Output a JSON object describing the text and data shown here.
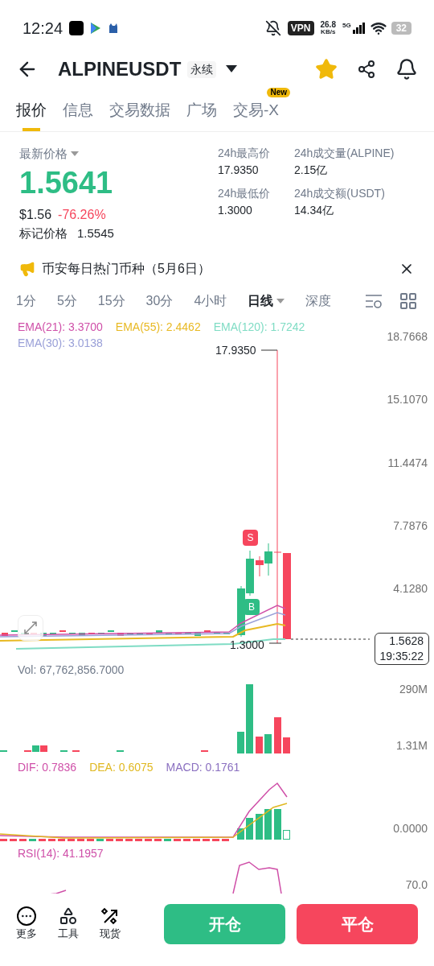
{
  "status_bar": {
    "time": "12:24",
    "vpn": "VPN",
    "speed": "26.8",
    "speed_unit": "KB/s",
    "network": "5G",
    "battery": "32"
  },
  "header": {
    "symbol": "ALPINEUSDT",
    "contract": "永续",
    "favorite": true
  },
  "tabs": [
    {
      "label": "报价",
      "selected": true
    },
    {
      "label": "信息",
      "selected": false
    },
    {
      "label": "交易数据",
      "selected": false
    },
    {
      "label": "广场",
      "selected": false
    },
    {
      "label": "交易-X",
      "selected": false,
      "badge": "New"
    }
  ],
  "price": {
    "label": "最新价格",
    "last": "1.5641",
    "usd": "$1.56",
    "change": "-76.26%",
    "mark_label": "标记价格",
    "mark": "1.5545"
  },
  "stats": [
    {
      "label": "24h最高价",
      "value": "17.9350"
    },
    {
      "label": "24h成交量(ALPINE)",
      "value": "2.15亿"
    },
    {
      "label": "24h最低价",
      "value": "1.3000"
    },
    {
      "label": "24h成交额(USDT)",
      "value": "14.34亿"
    }
  ],
  "banner": {
    "text": "币安每日热门币种（5月6日）"
  },
  "intervals": [
    {
      "label": "1分",
      "selected": false
    },
    {
      "label": "5分",
      "selected": false
    },
    {
      "label": "15分",
      "selected": false
    },
    {
      "label": "30分",
      "selected": false
    },
    {
      "label": "4小时",
      "selected": false
    },
    {
      "label": "日线",
      "selected": true
    },
    {
      "label": "深度",
      "selected": false
    }
  ],
  "chart": {
    "legend": [
      {
        "label": "EMA(21): 3.3700",
        "color": "#cf4fa8"
      },
      {
        "label": "EMA(55): 2.4462",
        "color": "#e8b923"
      },
      {
        "label": "EMA(120): 1.7242",
        "color": "#7fdcc4"
      },
      {
        "label": "EMA(30): 3.0138",
        "color": "#9aa0d8"
      }
    ],
    "y_labels": [
      "18.7668",
      "15.1070",
      "11.4474",
      "7.7876",
      "4.1280"
    ],
    "high_label": "17.9350",
    "low_label": "1.3000",
    "sell_mark": "S",
    "buy_mark": "B",
    "price_tag": "1.5628",
    "countdown": "19:35:22"
  },
  "volume": {
    "label": "Vol: 67,762,856.7000",
    "y_labels": [
      "290M",
      "1.31M"
    ]
  },
  "macd": {
    "legend": [
      {
        "label": "DIF: 0.7836",
        "color": "#cf4fa8"
      },
      {
        "label": "DEA: 0.6075",
        "color": "#e0b820"
      },
      {
        "label": "MACD: 0.1761",
        "color": "#8a6fc0"
      }
    ],
    "y_labels": [
      "0.0000"
    ]
  },
  "rsi": {
    "legend": [
      {
        "label": "RSI(14): 41.1957",
        "color": "#cf4fa8"
      }
    ],
    "y_labels": [
      "70.0"
    ]
  },
  "bottom": {
    "tools": [
      {
        "label": "更多",
        "kind": "more"
      },
      {
        "label": "工具",
        "kind": "tools"
      },
      {
        "label": "现货",
        "kind": "spot"
      }
    ],
    "buttons": [
      {
        "label": "开仓",
        "kind": "open"
      },
      {
        "label": "平仓",
        "kind": "close"
      }
    ]
  }
}
